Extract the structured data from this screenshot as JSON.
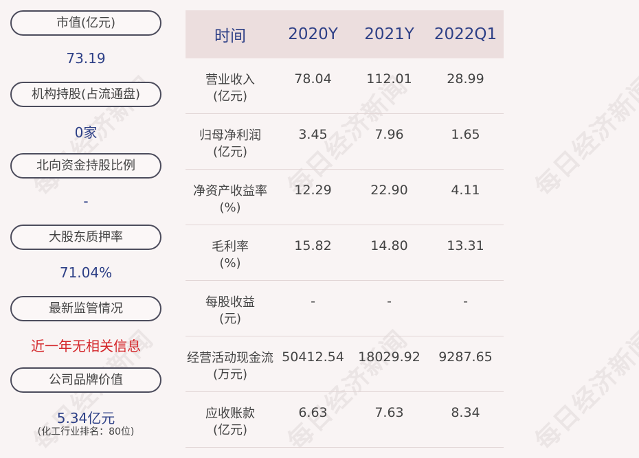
{
  "watermark": "每日经济新闻",
  "left_panel": [
    {
      "label": "市值(亿元)",
      "value": "73.19",
      "color": "blue"
    },
    {
      "label": "机构持股(占流通盘)",
      "value": "0家",
      "color": "blue"
    },
    {
      "label": "北向资金持股比例",
      "value": "-",
      "color": "blue"
    },
    {
      "label": "大股东质押率",
      "value": "71.04%",
      "color": "blue"
    },
    {
      "label": "最新监管情况",
      "value": "近一年无相关信息",
      "color": "red"
    },
    {
      "label": "公司品牌价值",
      "value": "5.34亿元",
      "color": "blue",
      "note": "(化工行业排名：80位)"
    }
  ],
  "table": {
    "headers": [
      "时间",
      "2020Y",
      "2021Y",
      "2022Q1"
    ],
    "rows": [
      {
        "label1": "营业收入",
        "label2": "(亿元)",
        "values": [
          "78.04",
          "112.01",
          "28.99"
        ]
      },
      {
        "label1": "归母净利润",
        "label2": "(亿元)",
        "values": [
          "3.45",
          "7.96",
          "1.65"
        ]
      },
      {
        "label1": "净资产收益率",
        "label2": "(%)",
        "values": [
          "12.29",
          "22.90",
          "4.11"
        ]
      },
      {
        "label1": "毛利率",
        "label2": "(%)",
        "values": [
          "15.82",
          "14.80",
          "13.31"
        ]
      },
      {
        "label1": "每股收益",
        "label2": "(元)",
        "values": [
          "-",
          "-",
          "-"
        ]
      },
      {
        "label1": "经营活动现金流",
        "label2": "(万元)",
        "values": [
          "50412.54",
          "18029.92",
          "9287.65"
        ]
      },
      {
        "label1": "应收账款",
        "label2": "(亿元)",
        "values": [
          "6.63",
          "7.63",
          "8.34"
        ]
      }
    ]
  },
  "colors": {
    "blue": "#2d3f86",
    "red": "#d4262a",
    "header_bg": "#ecdede",
    "background": "#f9f4f4"
  }
}
